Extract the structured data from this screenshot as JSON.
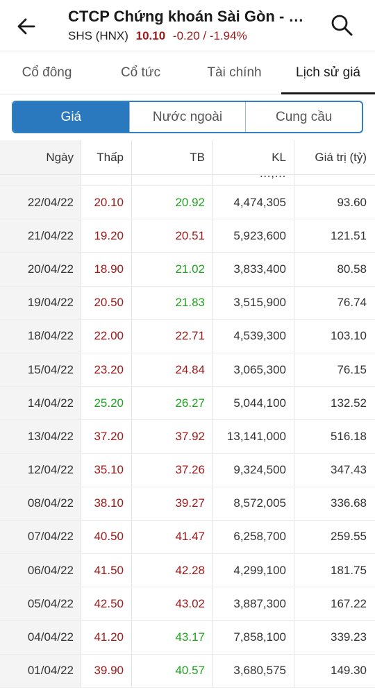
{
  "header": {
    "title": "CTCP Chứng khoán Sài Gòn - Hà Nội",
    "symbol": "SHS (HNX)",
    "price": "10.10",
    "change": "-0.20 / -1.94%"
  },
  "tabs": [
    {
      "label": "Cổ đông",
      "active": false
    },
    {
      "label": "Cổ tức",
      "active": false
    },
    {
      "label": "Tài chính",
      "active": false
    },
    {
      "label": "Lịch sử giá",
      "active": true
    }
  ],
  "segments": [
    {
      "label": "Giá",
      "active": true
    },
    {
      "label": "Nước ngoài",
      "active": false
    },
    {
      "label": "Cung cầu",
      "active": false
    }
  ],
  "table": {
    "headers": [
      "Ngày",
      "Thấp",
      "TB",
      "KL",
      "Giá trị (tỷ)"
    ],
    "partial_row_kl": "…,…",
    "rows": [
      {
        "date": "22/04/22",
        "low": "20.10",
        "low_color": "red",
        "avg": "20.92",
        "avg_color": "green",
        "vol": "4,474,305",
        "val": "93.60"
      },
      {
        "date": "21/04/22",
        "low": "19.20",
        "low_color": "red",
        "avg": "20.51",
        "avg_color": "red",
        "vol": "5,923,600",
        "val": "121.51"
      },
      {
        "date": "20/04/22",
        "low": "18.90",
        "low_color": "red",
        "avg": "21.02",
        "avg_color": "green",
        "vol": "3,833,400",
        "val": "80.58"
      },
      {
        "date": "19/04/22",
        "low": "20.50",
        "low_color": "red",
        "avg": "21.83",
        "avg_color": "green",
        "vol": "3,515,900",
        "val": "76.74"
      },
      {
        "date": "18/04/22",
        "low": "22.00",
        "low_color": "red",
        "avg": "22.71",
        "avg_color": "red",
        "vol": "4,539,300",
        "val": "103.10"
      },
      {
        "date": "15/04/22",
        "low": "23.20",
        "low_color": "red",
        "avg": "24.84",
        "avg_color": "red",
        "vol": "3,065,300",
        "val": "76.15"
      },
      {
        "date": "14/04/22",
        "low": "25.20",
        "low_color": "green",
        "avg": "26.27",
        "avg_color": "green",
        "vol": "5,044,100",
        "val": "132.52"
      },
      {
        "date": "13/04/22",
        "low": "37.20",
        "low_color": "red",
        "avg": "37.92",
        "avg_color": "red",
        "vol": "13,141,000",
        "val": "516.18"
      },
      {
        "date": "12/04/22",
        "low": "35.10",
        "low_color": "red",
        "avg": "37.26",
        "avg_color": "red",
        "vol": "9,324,500",
        "val": "347.43"
      },
      {
        "date": "08/04/22",
        "low": "38.10",
        "low_color": "red",
        "avg": "39.27",
        "avg_color": "red",
        "vol": "8,572,005",
        "val": "336.68"
      },
      {
        "date": "07/04/22",
        "low": "40.50",
        "low_color": "red",
        "avg": "41.47",
        "avg_color": "red",
        "vol": "6,258,700",
        "val": "259.55"
      },
      {
        "date": "06/04/22",
        "low": "41.50",
        "low_color": "red",
        "avg": "42.28",
        "avg_color": "red",
        "vol": "4,299,100",
        "val": "181.75"
      },
      {
        "date": "05/04/22",
        "low": "42.50",
        "low_color": "red",
        "avg": "43.02",
        "avg_color": "red",
        "vol": "3,887,300",
        "val": "167.22"
      },
      {
        "date": "04/04/22",
        "low": "41.20",
        "low_color": "red",
        "avg": "43.17",
        "avg_color": "green",
        "vol": "7,858,100",
        "val": "339.23"
      },
      {
        "date": "01/04/22",
        "low": "39.90",
        "low_color": "red",
        "avg": "40.57",
        "avg_color": "green",
        "vol": "3,680,575",
        "val": "149.30"
      }
    ]
  },
  "colors": {
    "red": "#a01919",
    "green": "#1ea31e",
    "accent": "#2a78be"
  },
  "icons": {
    "back": "arrow-left-icon",
    "search": "search-icon"
  }
}
